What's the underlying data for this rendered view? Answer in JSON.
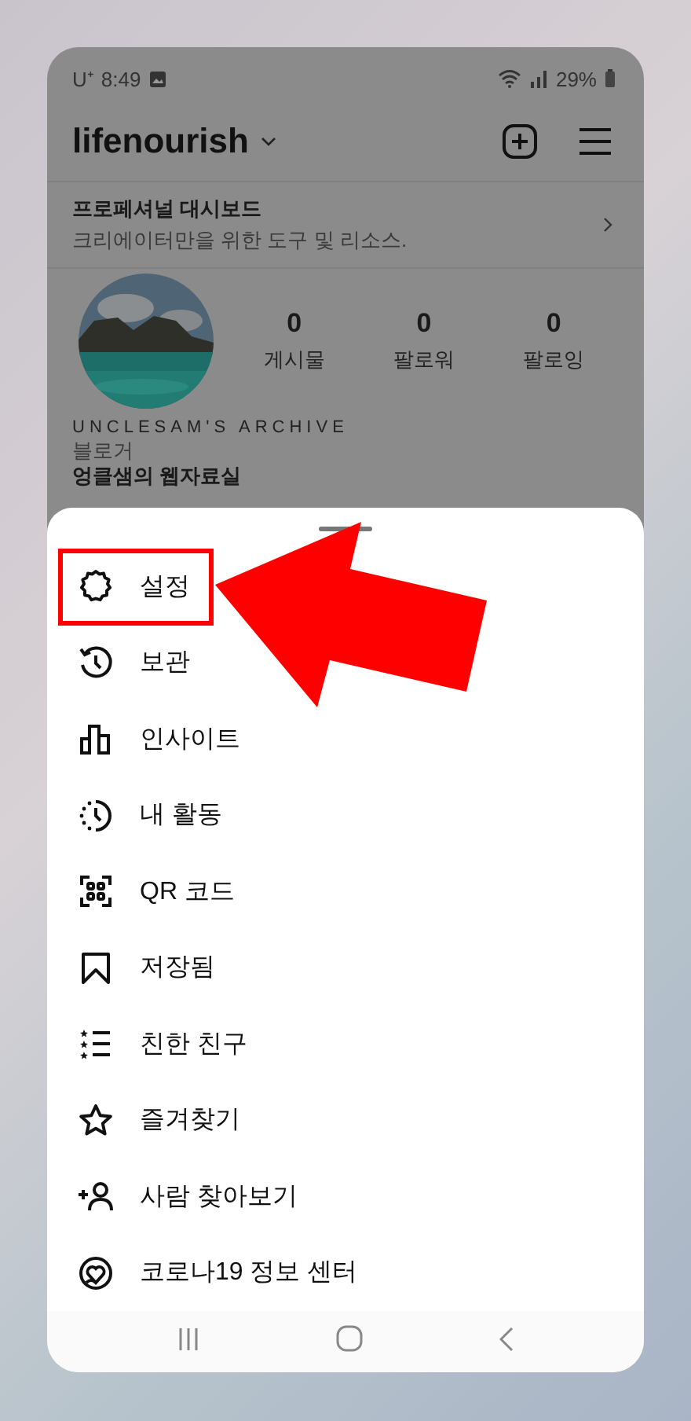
{
  "status_bar": {
    "carrier": "U⁺",
    "time": "8:49",
    "battery": "29%"
  },
  "header": {
    "username": "lifenourish"
  },
  "dashboard": {
    "title": "프로페셔널 대시보드",
    "subtitle": "크리에이터만을 위한 도구 및 리소스."
  },
  "profile": {
    "stats": [
      {
        "count": "0",
        "label": "게시물"
      },
      {
        "count": "0",
        "label": "팔로워"
      },
      {
        "count": "0",
        "label": "팔로잉"
      }
    ],
    "display_name": "UNCLESAM'S ARCHIVE",
    "category": "블로거",
    "bio": "엉클샘의 웹자료실"
  },
  "menu": [
    {
      "label": "설정",
      "highlighted": true
    },
    {
      "label": "보관",
      "highlighted": false
    },
    {
      "label": "인사이트",
      "highlighted": false
    },
    {
      "label": "내 활동",
      "highlighted": false
    },
    {
      "label": "QR 코드",
      "highlighted": false
    },
    {
      "label": "저장됨",
      "highlighted": false
    },
    {
      "label": "친한 친구",
      "highlighted": false
    },
    {
      "label": "즐겨찾기",
      "highlighted": false
    },
    {
      "label": "사람 찾아보기",
      "highlighted": false
    },
    {
      "label": "코로나19 정보 센터",
      "highlighted": false
    }
  ]
}
